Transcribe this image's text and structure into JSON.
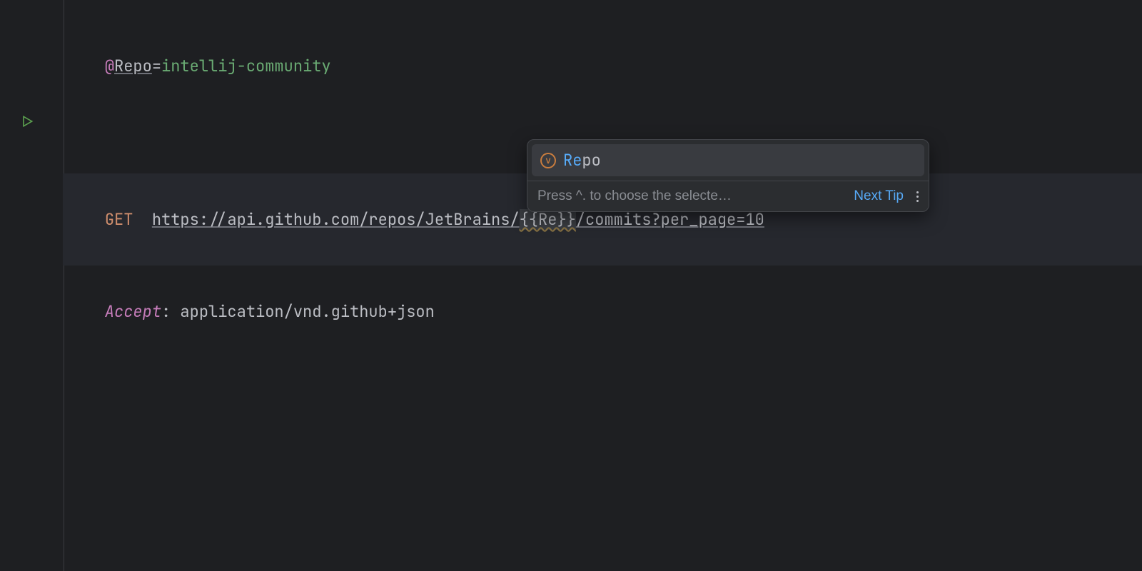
{
  "editor": {
    "line1": {
      "at": "@",
      "var_name": "Repo",
      "equals": "=",
      "var_value": "intellij-community"
    },
    "line4": {
      "method": "GET",
      "url_part1": "https://api.github.com/repos/JetBrains/",
      "template": "{{Re}}",
      "url_part2": "/commits?per_page=10"
    },
    "line5": {
      "header_name": "Accept",
      "colon": ": ",
      "header_value": "application/vnd.github+json"
    }
  },
  "popup": {
    "item": {
      "icon_letter": "v",
      "match": "Re",
      "rest": "po"
    },
    "footer": {
      "hint": "Press ^. to choose the selecte…",
      "next_tip": "Next Tip"
    }
  }
}
